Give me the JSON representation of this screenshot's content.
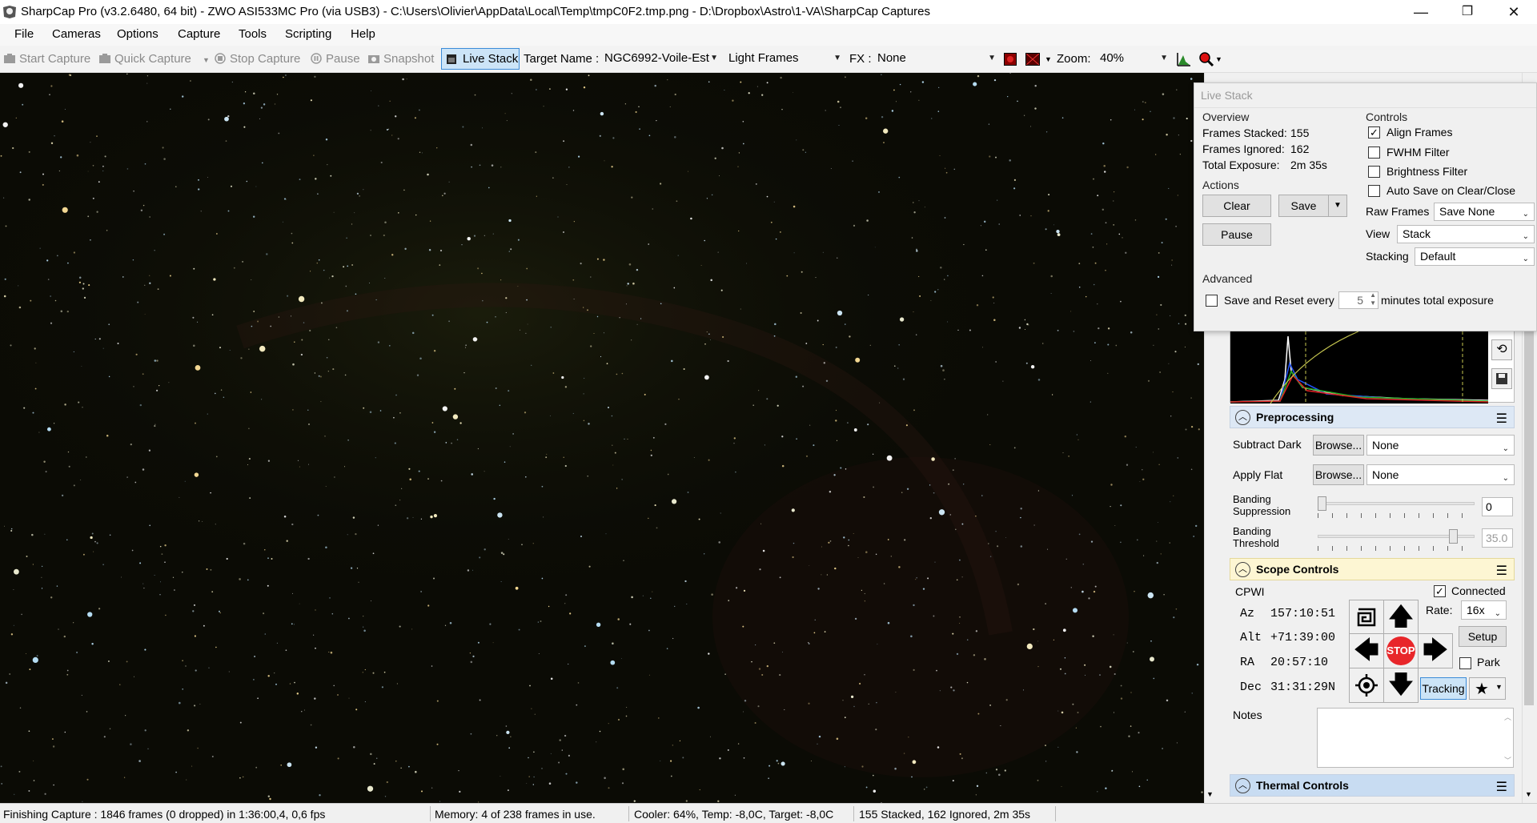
{
  "window": {
    "title": "SharpCap Pro (v3.2.6480, 64 bit) - ZWO ASI533MC Pro (via USB3) - C:\\Users\\Olivier\\AppData\\Local\\Temp\\tmpC0F2.tmp.png - D:\\Dropbox\\Astro\\1-VA\\SharpCap Captures",
    "minimize": "—",
    "restore": "❐",
    "close": "✕"
  },
  "menu": [
    "File",
    "Cameras",
    "Options",
    "Capture",
    "Tools",
    "Scripting",
    "Help"
  ],
  "toolbar": {
    "start_capture": "Start Capture",
    "quick_capture": "Quick Capture",
    "stop_capture": "Stop Capture",
    "pause": "Pause",
    "snapshot": "Snapshot",
    "live_stack": "Live Stack",
    "target_name_label": "Target Name :",
    "target_name_value": "NGC6992-Voile-Est",
    "frame_type": "Light Frames",
    "fx_label": "FX :",
    "fx_value": "None",
    "zoom_label": "Zoom:",
    "zoom_value": "40%"
  },
  "live_stack": {
    "title": "Live Stack",
    "overview_label": "Overview",
    "frames_stacked_label": "Frames Stacked:",
    "frames_stacked_value": "155",
    "frames_ignored_label": "Frames Ignored:",
    "frames_ignored_value": "162",
    "total_exposure_label": "Total Exposure:",
    "total_exposure_value": "2m 35s",
    "actions_label": "Actions",
    "clear": "Clear",
    "save": "Save",
    "pause": "Pause",
    "controls_label": "Controls",
    "align_frames": "Align Frames",
    "align_frames_checked": true,
    "fwhm_filter": "FWHM Filter",
    "brightness_filter": "Brightness Filter",
    "auto_save": "Auto Save on Clear/Close",
    "raw_frames_label": "Raw Frames",
    "raw_frames_value": "Save None",
    "view_label": "View",
    "view_value": "Stack",
    "stacking_label": "Stacking",
    "stacking_value": "Default",
    "advanced_label": "Advanced",
    "save_reset_label": "Save and Reset every",
    "save_reset_value": "5",
    "save_reset_suffix": "minutes total exposure"
  },
  "preprocessing": {
    "title": "Preprocessing",
    "subtract_dark_label": "Subtract Dark",
    "subtract_dark_browse": "Browse...",
    "subtract_dark_value": "None",
    "apply_flat_label": "Apply Flat",
    "apply_flat_browse": "Browse...",
    "apply_flat_value": "None",
    "banding_suppression_label_1": "Banding",
    "banding_suppression_label_2": "Suppression",
    "banding_suppression_value": "0",
    "banding_threshold_label_1": "Banding",
    "banding_threshold_label_2": "Threshold",
    "banding_threshold_value": "35.0",
    "banding_suppression_level": 0,
    "banding_threshold_level": 0.88
  },
  "scope": {
    "title": "Scope Controls",
    "mount": "CPWI",
    "connected": "Connected",
    "az_label": "Az",
    "az_value": "157:10:51",
    "alt_label": "Alt",
    "alt_value": "+71:39:00",
    "ra_label": "RA",
    "ra_value": "20:57:10",
    "dec_label": "Dec",
    "dec_value": "31:31:29N",
    "rate_label": "Rate:",
    "rate_value": "16x",
    "setup": "Setup",
    "park": "Park",
    "stop": "STOP",
    "tracking": "Tracking",
    "notes_label": "Notes"
  },
  "thermal": {
    "title": "Thermal Controls"
  },
  "status": {
    "capture": "Finishing Capture : 1846 frames (0 dropped) in 1:36:00,4, 0,6 fps",
    "memory": "Memory: 4 of 238 frames in use.",
    "cooler": "Cooler: 64%, Temp: -8,0C, Target: -8,0C",
    "stack": "155 Stacked, 162 Ignored, 2m 35s"
  },
  "colors": {
    "accent_blue": "#cce4f7",
    "section_head": "#dde8f5",
    "scope_head": "#fdf6d3",
    "stop_red": "#e8262a"
  }
}
